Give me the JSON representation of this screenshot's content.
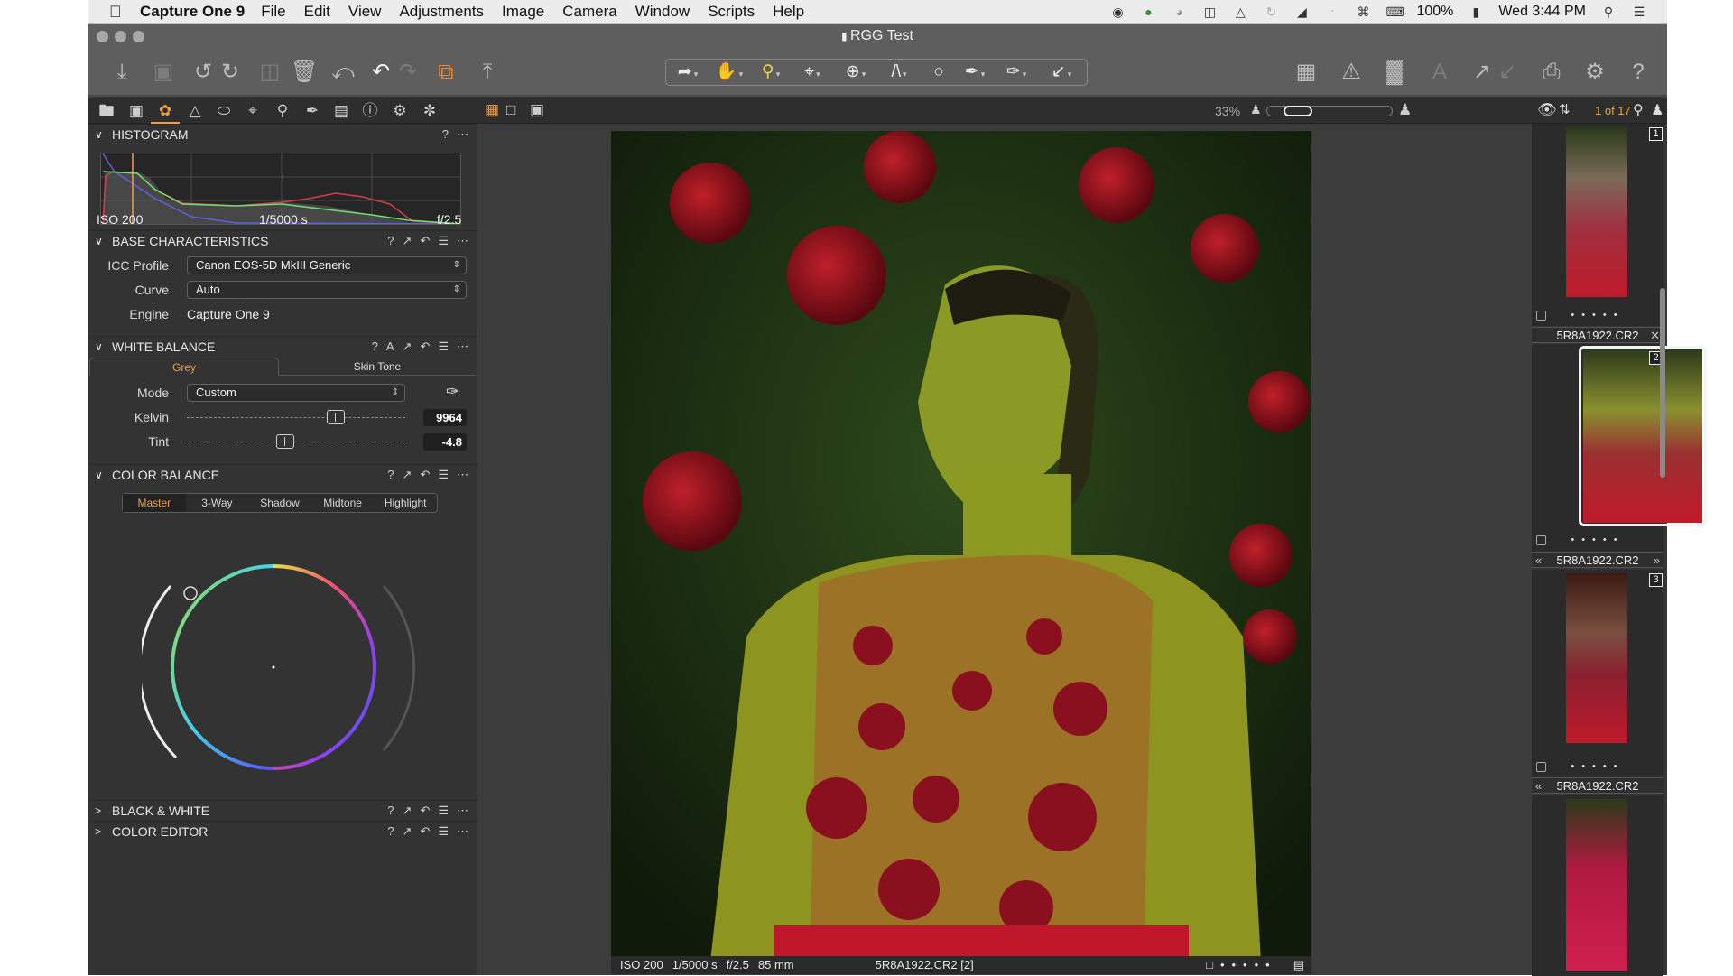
{
  "menubar": {
    "app_name": "Capture One 9",
    "items": [
      "File",
      "Edit",
      "View",
      "Adjustments",
      "Image",
      "Camera",
      "Window",
      "Scripts",
      "Help"
    ],
    "status_icons": [
      "record-icon",
      "vpn-icon",
      "headphones-icon",
      "sidebar-icon",
      "airplay-icon",
      "time-machine-icon",
      "volume-icon",
      "bluetooth-icon",
      "wifi-icon",
      "keyboard-icon"
    ],
    "battery": "100%",
    "clock": "Wed 3:44 PM"
  },
  "window": {
    "title": "RGG Test"
  },
  "toolbar": {
    "left_tools": [
      "import-icon",
      "capture-icon",
      "rotate-left-icon",
      "rotate-right-icon",
      "move-to-folder-icon",
      "delete-icon",
      "reset-icon",
      "undo-icon",
      "redo-icon",
      "stack-icon",
      "export-icon"
    ],
    "cursor_tools": [
      "select-icon",
      "pan-icon",
      "zoom-tool-icon",
      "crop-icon",
      "rotate-icon",
      "keystone-icon",
      "spot-icon",
      "brush-icon",
      "color-picker-icon",
      "copy-apply-icon"
    ],
    "right_tools": [
      "grid-layout-icon",
      "exposure-warning-icon",
      "grid-icon",
      "text-icon",
      "copy-adjustments-icon",
      "apply-adjustments-icon",
      "print-icon",
      "settings-icon",
      "help-icon"
    ]
  },
  "left_panel": {
    "tool_tabs": [
      "library",
      "capture",
      "color",
      "exposure",
      "lens",
      "composition",
      "details",
      "local-adjustments",
      "adjustments",
      "metadata",
      "output",
      "batch"
    ],
    "histogram": {
      "title": "HISTOGRAM",
      "iso": "ISO 200",
      "shutter": "1/5000 s",
      "aperture": "f/2.5"
    },
    "base": {
      "title": "BASE CHARACTERISTICS",
      "icc_label": "ICC Profile",
      "icc_value": "Canon EOS-5D MkIII Generic",
      "curve_label": "Curve",
      "curve_value": "Auto",
      "engine_label": "Engine",
      "engine_value": "Capture One 9"
    },
    "white_balance": {
      "title": "WHITE BALANCE",
      "tabs": [
        "Grey",
        "Skin Tone"
      ],
      "mode_label": "Mode",
      "mode_value": "Custom",
      "kelvin_label": "Kelvin",
      "kelvin_value": "9964",
      "kelvin_fraction": 0.68,
      "tint_label": "Tint",
      "tint_value": "-4.8",
      "tint_fraction": 0.45
    },
    "color_balance": {
      "title": "COLOR BALANCE",
      "tabs": [
        "Master",
        "3-Way",
        "Shadow",
        "Midtone",
        "Highlight"
      ],
      "active_tab": "Master"
    },
    "collapsed": [
      "BLACK & WHITE",
      "COLOR EDITOR"
    ]
  },
  "viewer": {
    "zoom": "33%",
    "counter": "1 of 17",
    "info": {
      "iso": "ISO 200",
      "shutter": "1/5000 s",
      "aperture": "f/2.5",
      "focal": "85 mm",
      "file": "5R8A1922.CR2 [2]"
    }
  },
  "browser": {
    "thumbs": [
      {
        "num": "1",
        "name": "5R8A1922.CR2"
      },
      {
        "num": "2",
        "name": "5R8A1922.CR2",
        "selected": true
      },
      {
        "num": "3",
        "name": "5R8A1922.CR2"
      }
    ]
  },
  "colors": {
    "accent": "#f0a040",
    "panel": "#333333",
    "toolbar": "#5e5e5e"
  }
}
